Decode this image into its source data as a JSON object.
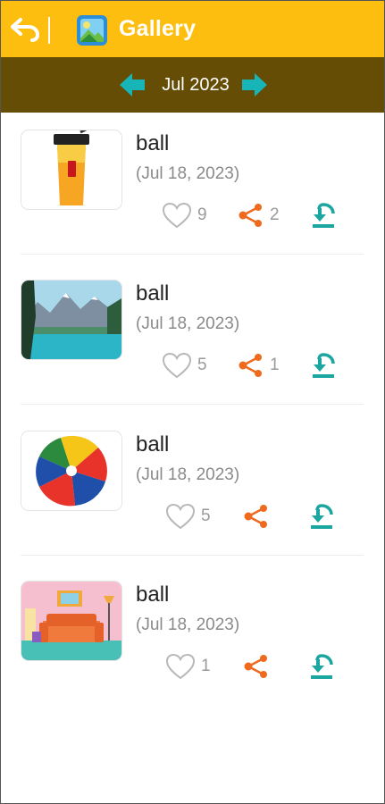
{
  "header": {
    "title": "Gallery",
    "back_icon": "back-arrow-icon",
    "app_icon": "gallery-icon",
    "background_color": "#FEBE10"
  },
  "month_nav": {
    "label": "Jul 2023",
    "prev_icon": "prev-month-arrow-icon",
    "next_icon": "next-month-arrow-icon",
    "background_color": "#654D05",
    "arrow_color": "#17B5B8"
  },
  "items": [
    {
      "title": "ball",
      "date": "(Jul 18, 2023)",
      "thumbnail": "iced-drink-thumbnail",
      "likes": "9",
      "shares": "2"
    },
    {
      "title": "ball",
      "date": "(Jul 18, 2023)",
      "thumbnail": "mountain-lake-thumbnail",
      "likes": "5",
      "shares": "1"
    },
    {
      "title": "ball",
      "date": "(Jul 18, 2023)",
      "thumbnail": "beach-ball-thumbnail",
      "likes": "5",
      "shares": ""
    },
    {
      "title": "ball",
      "date": "(Jul 18, 2023)",
      "thumbnail": "living-room-thumbnail",
      "likes": "1",
      "shares": ""
    }
  ],
  "icons": {
    "like": "heart-outline-icon",
    "share": "share-icon",
    "download": "download-icon"
  },
  "colors": {
    "share": "#EE6A1E",
    "download": "#1BA6A0",
    "heart": "#B8B8B8"
  }
}
